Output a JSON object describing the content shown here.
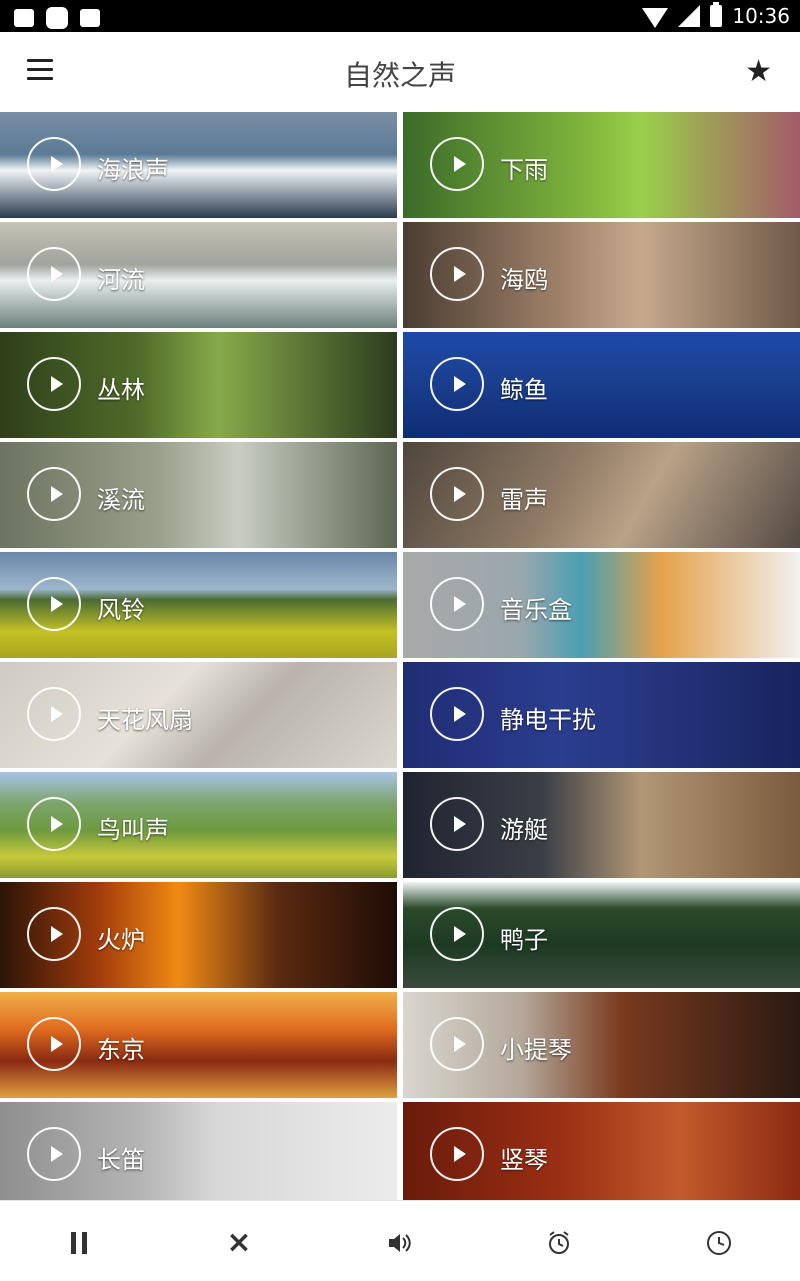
{
  "status_bar": {
    "time": "10:36"
  },
  "app_bar": {
    "title": "自然之声",
    "menu_icon": "menu-icon",
    "favorite_icon": "star-icon"
  },
  "tiles": [
    {
      "label": "海浪声",
      "bg": "linear-gradient(180deg,#7b8ea3 0%,#5b7a96 40%,#f0f4f6 55%,#2b3b4f 100%)"
    },
    {
      "label": "下雨",
      "bg": "linear-gradient(90deg,#3b6b2a 0%,#7fb33c 45%,#9acf4a 60%,#a35b6b 100%)"
    },
    {
      "label": "河流",
      "bg": "linear-gradient(180deg,#c7c2b5 0%,#9fa49d 40%,#e9f0ef 55%,#6c7f7b 100%)"
    },
    {
      "label": "海鸥",
      "bg": "linear-gradient(90deg,#4b3d32 0%,#a0826a 40%,#c6a98d 60%,#6f5a48 100%)"
    },
    {
      "label": "丛林",
      "bg": "linear-gradient(90deg,#2f3f1a 0%,#506b2a 35%,#87aa4b 55%,#2c3b1f 100%)"
    },
    {
      "label": "鲸鱼",
      "bg": "linear-gradient(180deg,#1d4aa8 0%,#1b3f8f 45%,#0e2d73 100%)"
    },
    {
      "label": "溪流",
      "bg": "linear-gradient(90deg,#6c7360 0%,#9aa08b 40%,#c9cdc4 60%,#5d6652 100%)"
    },
    {
      "label": "雷声",
      "bg": "linear-gradient(120deg,#4f463d 0%,#8f7a65 40%,#b9a287 60%,#544a44 100%)"
    },
    {
      "label": "风铃",
      "bg": "linear-gradient(180deg,#6b87a9 0%,#9db6cc 35%,#4a6b33 45%,#c4c227 75%,#a8a420 100%)"
    },
    {
      "label": "音乐盒",
      "bg": "linear-gradient(90deg,#a9a9a9 0%,#9aa7ad 30%,#4a9fb2 45%,#e5a24a 65%,#f1f1f1 100%)"
    },
    {
      "label": "天花风扇",
      "bg": "linear-gradient(135deg,#cfcac2 0%,#e6e1d9 40%,#b9b3ab 60%,#ddd8cf 100%)"
    },
    {
      "label": "静电干扰",
      "bg": "linear-gradient(90deg,#1f2d74 0%,#2b3d8f 40%,#233278 70%,#18245f 100%)"
    },
    {
      "label": "鸟叫声",
      "bg": "linear-gradient(180deg,#a6c4e6 0%,#7ca46a 30%,#6d9a3f 55%,#c8c93c 80%,#8a9b2f 100%)"
    },
    {
      "label": "游艇",
      "bg": "linear-gradient(90deg,#1f2430 0%,#3a3e46 35%,#b19775 60%,#7b5b3d 100%)"
    },
    {
      "label": "火炉",
      "bg": "linear-gradient(90deg,#2b1407 0%,#a33c0c 25%,#f08a14 45%,#5a2a12 70%,#1f0c05 100%)"
    },
    {
      "label": "鸭子",
      "bg": "linear-gradient(180deg,#f0f4f7 0%,#2a4a2a 25%,#1c3a22 60%,#3b4a3d 100%)"
    },
    {
      "label": "东京",
      "bg": "linear-gradient(180deg,#f0b04a 0%,#e06c1f 35%,#8a2a12 65%,#e0a040 100%)"
    },
    {
      "label": "小提琴",
      "bg": "linear-gradient(90deg,#d9d6d0 0%,#b4a89a 30%,#7a3a1f 55%,#2b1a12 100%)"
    },
    {
      "label": "长笛",
      "bg": "linear-gradient(90deg,#8f8f8f 0%,#b4b4b4 35%,#d8d8d8 55%,#ececec 100%)"
    },
    {
      "label": "竖琴",
      "bg": "linear-gradient(90deg,#6a1b0b 0%,#9b2f14 40%,#c35a2c 70%,#8a2a12 100%)"
    }
  ],
  "bottom_bar": {
    "buttons": [
      "pause-icon",
      "close-icon",
      "volume-icon",
      "alarm-icon",
      "timer-icon"
    ]
  }
}
